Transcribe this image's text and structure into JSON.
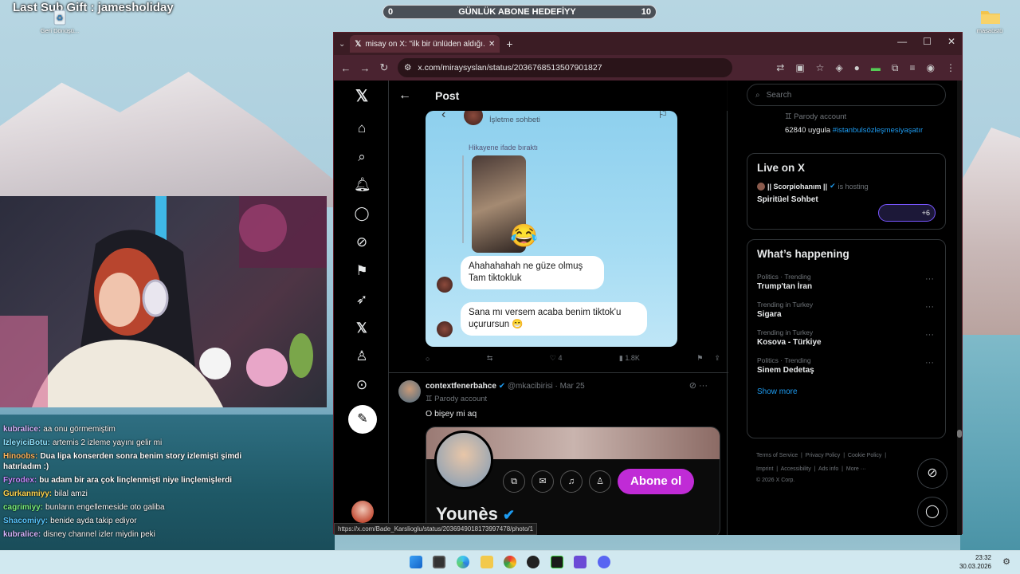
{
  "overlay": {
    "sub_gift": "Last Sub Gift : jamesholiday",
    "goal": {
      "label": "GÜNLÜK ABONE HEDEFİYY",
      "current": "0",
      "target": "10",
      "progress": 0
    }
  },
  "desktop": {
    "recycle_bin": "Geri Dönüşü...",
    "folder": "masaüstü"
  },
  "chat": [
    {
      "user": "kubralice:",
      "msg": "aa onu görmemiştim",
      "color": "#d7b6ff"
    },
    {
      "user": "IzleyiciBotu:",
      "msg": "artemis 2 izleme yayını gelir mi",
      "color": "#8fe3ff"
    },
    {
      "user": "Hinoobs:",
      "msg": "Dua lipa konserden sonra benim story izlemişti şimdi hatırladım :)",
      "color": "#ffb45a",
      "wrap": true
    },
    {
      "user": "Fyrodex:",
      "msg": "bu adam bir ara çok linçlenmişti niye linçlemişlerdi",
      "color": "#c58bff",
      "wrap": true
    },
    {
      "user": "Gurkanmiyy:",
      "msg": "bilal amzi",
      "color": "#ffd34d"
    },
    {
      "user": "cagrimiyy:",
      "msg": "bunların engellemeside oto galiba",
      "color": "#7af07a"
    },
    {
      "user": "Shacomiyy:",
      "msg": "benide ayda takip ediyor",
      "color": "#58c7ff"
    },
    {
      "user": "kubralice:",
      "msg": "disney channel izler miydin peki",
      "color": "#d7b6ff"
    }
  ],
  "browser": {
    "tab_title": "misay on X: \"ilk bir ünlüden aldığı...",
    "url": "x.com/miraysyslan/status/2036768513507901827",
    "status_url": "https://x.com/Bade_Karslioglu/status/2036949018173997478/photo/1"
  },
  "x": {
    "header_title": "Post",
    "dm": {
      "subtitle": "İşletme sohbeti",
      "reacted": "Hikayene ifade bıraktı",
      "msg1": "Ahahahahah ne güze olmuş Tam tiktokluk",
      "msg2": "Sana mı versem acaba benim tiktok'u uçurursun 😁"
    },
    "actions": {
      "likes": "4",
      "views": "1.8K"
    },
    "tweet2": {
      "name": "contextfenerbahce",
      "handle": "@mkacibirisi",
      "date": "· Mar 25",
      "badge": "Parody account",
      "text": "O bişey mi aq",
      "profile_name": "Younès",
      "subscribe": "Abone ol"
    },
    "sidebar": {
      "search_placeholder": "Search",
      "top_badge": "Parody account",
      "top_text": "62840 uygula",
      "top_hashtag": "#istanbulsözleşmesiyaşatır",
      "live_title": "Live on X",
      "live_host": "|| Scorpiohanım ||",
      "live_hosting": "is hosting",
      "live_space": "Spiritüel Sohbet",
      "live_count": "+6",
      "happening_title": "What’s happening",
      "trends": [
        {
          "context": "Politics · Trending",
          "name": "Trump'tan İran"
        },
        {
          "context": "Trending in Turkey",
          "name": "Sigara"
        },
        {
          "context": "Trending in Turkey",
          "name": "Kosova - Türkiye"
        },
        {
          "context": "Politics · Trending",
          "name": "Sinem Dedetaş"
        }
      ],
      "show_more": "Show more",
      "footer_line1": [
        "Terms of Service",
        "Privacy Policy",
        "Cookie Policy"
      ],
      "footer_line2": [
        "Imprint",
        "Accessibility",
        "Ads info",
        "More ···"
      ],
      "copyright": "© 2026 X Corp."
    }
  },
  "taskbar": {
    "time": "23:32",
    "date": "30.03.2026"
  },
  "colors": {
    "x_blue": "#1d9bf0",
    "x_bg": "#000000",
    "subscribe": "#c02bd6",
    "browser_frame": "#3b1c24"
  }
}
